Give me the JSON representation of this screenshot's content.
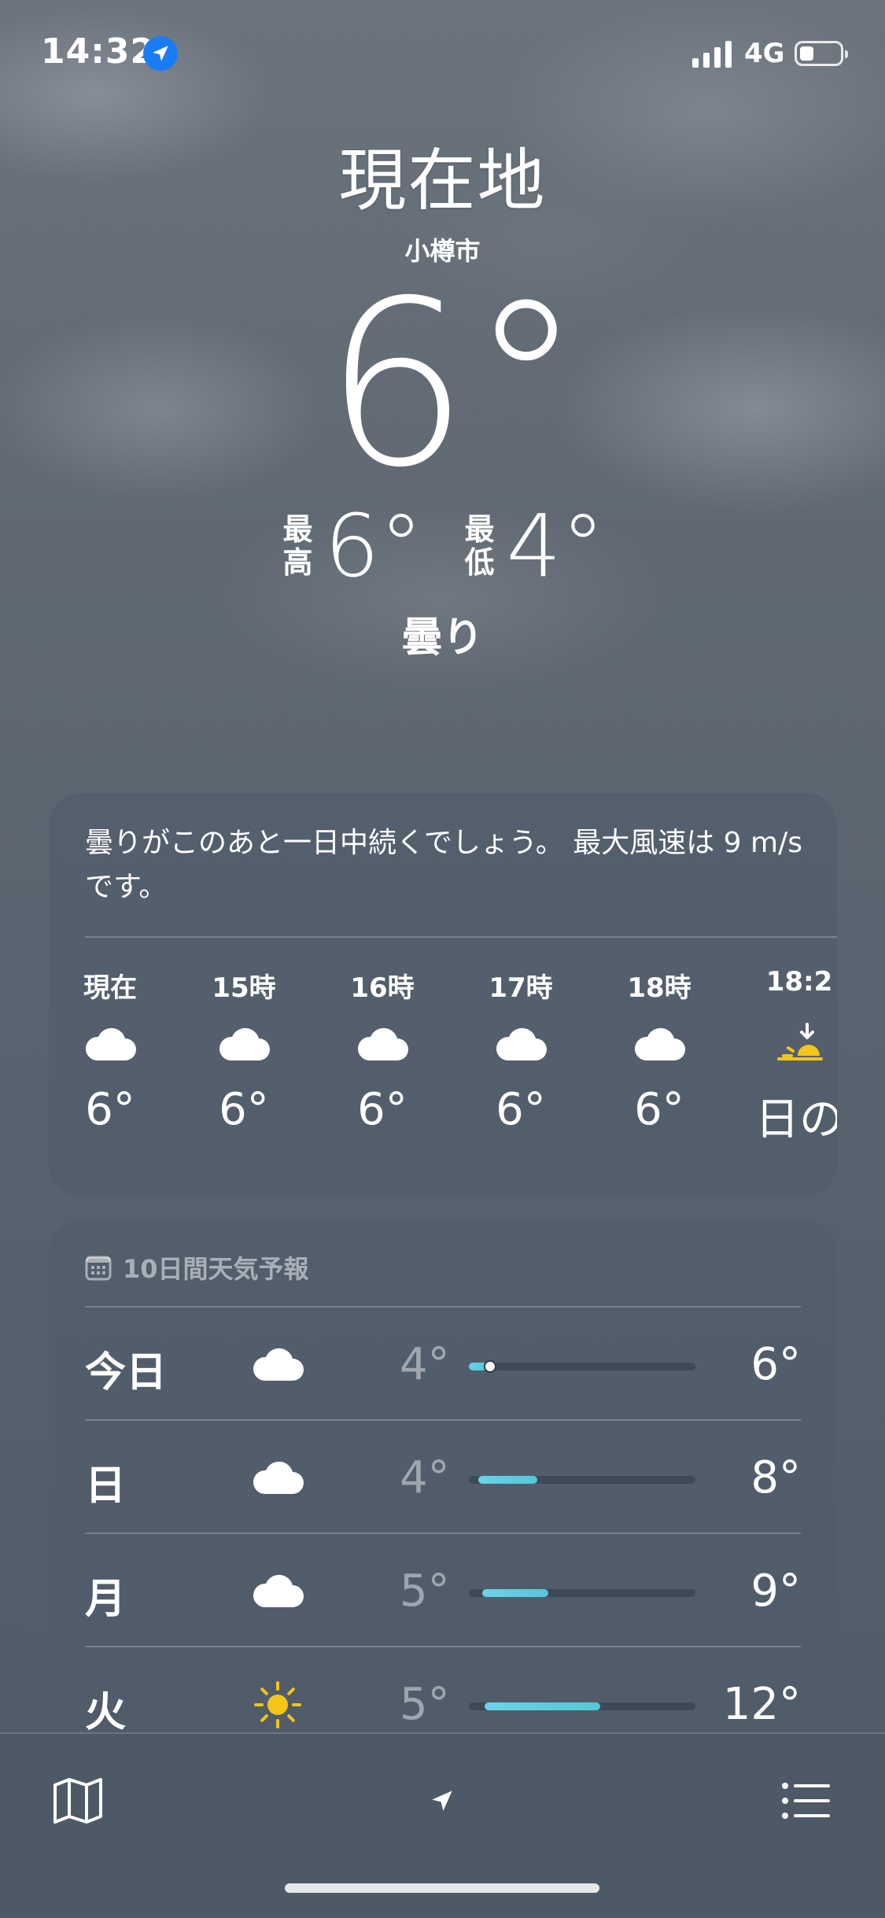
{
  "status_bar": {
    "time": "14:32",
    "network": "4G",
    "battery_level": 0.35
  },
  "header": {
    "location_title": "現在地",
    "city": "小樽市",
    "temperature": "6°",
    "high_label": "最高",
    "high": "6°",
    "low_label": "最低",
    "low": "4°",
    "condition": "曇り"
  },
  "hourly": {
    "summary": "曇りがこのあと一日中続くでしょう。 最大風速は 9 m/s です。",
    "items": [
      {
        "label": "現在",
        "icon": "cloud-icon",
        "temp": "6°"
      },
      {
        "label": "15時",
        "icon": "cloud-icon",
        "temp": "6°"
      },
      {
        "label": "16時",
        "icon": "cloud-icon",
        "temp": "6°"
      },
      {
        "label": "17時",
        "icon": "cloud-icon",
        "temp": "6°"
      },
      {
        "label": "18時",
        "icon": "cloud-icon",
        "temp": "6°"
      },
      {
        "label": "18:2",
        "icon": "sunset-icon",
        "temp": "日の"
      }
    ]
  },
  "forecast": {
    "header": "10日間天気予報",
    "days": [
      {
        "day": "今日",
        "icon": "cloud-icon",
        "low": "4°",
        "high": "6°",
        "range_start": 0.0,
        "range_end": 0.08,
        "current": 0.08
      },
      {
        "day": "日",
        "icon": "cloud-icon",
        "low": "4°",
        "high": "8°",
        "range_start": 0.04,
        "range_end": 0.3
      },
      {
        "day": "月",
        "icon": "cloud-icon",
        "low": "5°",
        "high": "9°",
        "range_start": 0.06,
        "range_end": 0.35
      },
      {
        "day": "火",
        "icon": "sun-icon",
        "low": "5°",
        "high": "12°",
        "range_start": 0.07,
        "range_end": 0.58
      }
    ]
  },
  "toolbar": {
    "map": "map-icon",
    "location": "location-arrow-icon",
    "list": "list-icon"
  },
  "colors": {
    "temp_bar": "#5ccbe0",
    "sun": "#f5c518",
    "location_badge": "#1a7cf5"
  }
}
